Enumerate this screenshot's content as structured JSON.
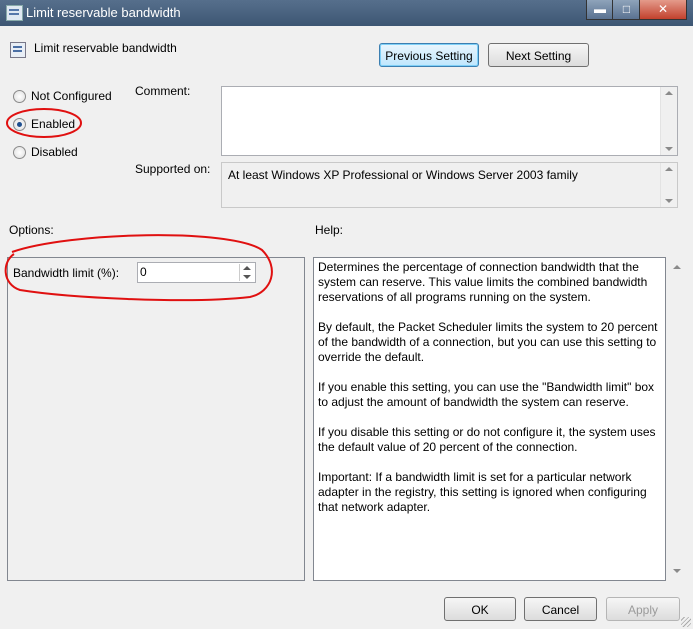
{
  "window": {
    "title": "Limit reservable bandwidth",
    "minimize_icon": "minimize-icon",
    "maximize_icon": "maximize-icon",
    "close_icon": "close-icon"
  },
  "header": {
    "policy_title": "Limit reservable bandwidth",
    "policy_icon": "policy-setting-icon"
  },
  "nav": {
    "previous_label": "Previous Setting",
    "next_label": "Next Setting"
  },
  "state": {
    "options": [
      {
        "label": "Not Configured",
        "selected": false
      },
      {
        "label": "Enabled",
        "selected": true
      },
      {
        "label": "Disabled",
        "selected": false
      }
    ]
  },
  "comment": {
    "label": "Comment:",
    "value": ""
  },
  "supported": {
    "label": "Supported on:",
    "value": "At least Windows XP Professional or Windows Server 2003 family"
  },
  "options": {
    "label": "Options:",
    "bandwidth_label": "Bandwidth limit (%):",
    "bandwidth_value": "0"
  },
  "help": {
    "label": "Help:",
    "paragraphs": [
      "Determines the percentage of connection bandwidth that the system can reserve. This value limits the combined bandwidth reservations of all programs running on the system.",
      "By default, the Packet Scheduler limits the system to 20 percent of the bandwidth of a connection, but you can use this setting to override the default.",
      "If you enable this setting, you can use the \"Bandwidth limit\" box to adjust the amount of bandwidth the system can reserve.",
      "If you disable this setting or do not configure it, the system uses the default value of 20 percent of the connection.",
      "Important: If a bandwidth limit is set for a particular network adapter in the registry, this setting is ignored when configuring that network adapter."
    ]
  },
  "footer": {
    "ok_label": "OK",
    "cancel_label": "Cancel",
    "apply_label": "Apply"
  },
  "annotation_color": "#e01010"
}
